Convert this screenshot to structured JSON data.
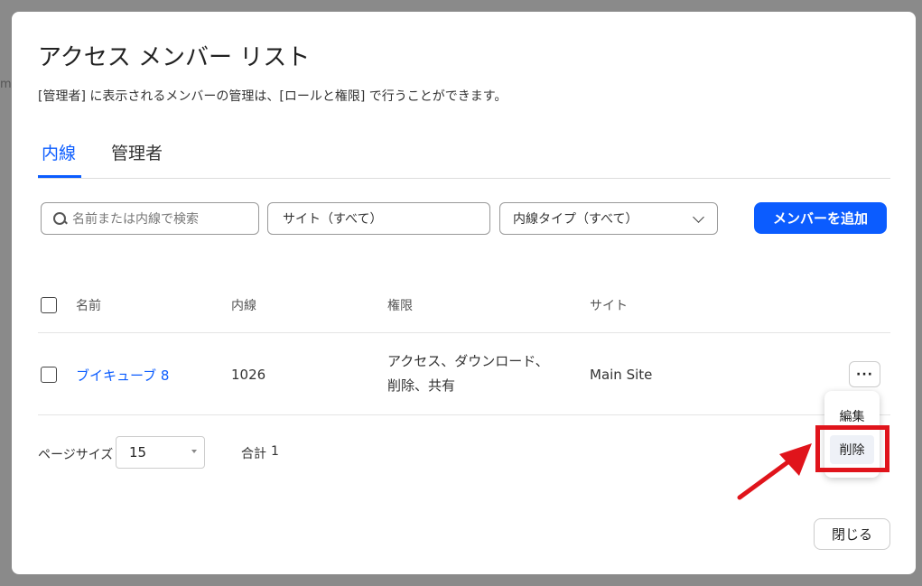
{
  "background": {
    "hint_text": "mp"
  },
  "dialog": {
    "title": "アクセス メンバー リスト",
    "subtitle": "[管理者] に表示されるメンバーの管理は、[ロールと権限] で行うことができます。",
    "tabs": [
      {
        "label": "内線",
        "active": true
      },
      {
        "label": "管理者",
        "active": false
      }
    ],
    "filters": {
      "search_placeholder": "名前または内線で検索",
      "site_value": "サイト（すべて）",
      "type_value": "内線タイプ（すべて）"
    },
    "add_button_label": "メンバーを追加",
    "table": {
      "headers": {
        "name": "名前",
        "extension": "内線",
        "permission": "権限",
        "site": "サイト"
      },
      "rows": [
        {
          "name": "ブイキューブ 8",
          "extension": "1026",
          "permission_lines": [
            "アクセス、ダウンロード、",
            "削除、共有"
          ],
          "site": "Main Site"
        }
      ]
    },
    "row_menu": {
      "more_icon": "more-horizontal-icon",
      "more_label": "···",
      "items": [
        {
          "label": "編集"
        },
        {
          "label": "削除",
          "highlighted": true
        }
      ]
    },
    "pagination": {
      "page_size_label": "ページサイズ",
      "page_size_value": "15",
      "total_label": "合計",
      "total_value": "1"
    },
    "close_button_label": "閉じる"
  },
  "colors": {
    "accent": "#0b5cff",
    "annotation_red": "#e0141b",
    "overlay": "#8a8a8a"
  }
}
